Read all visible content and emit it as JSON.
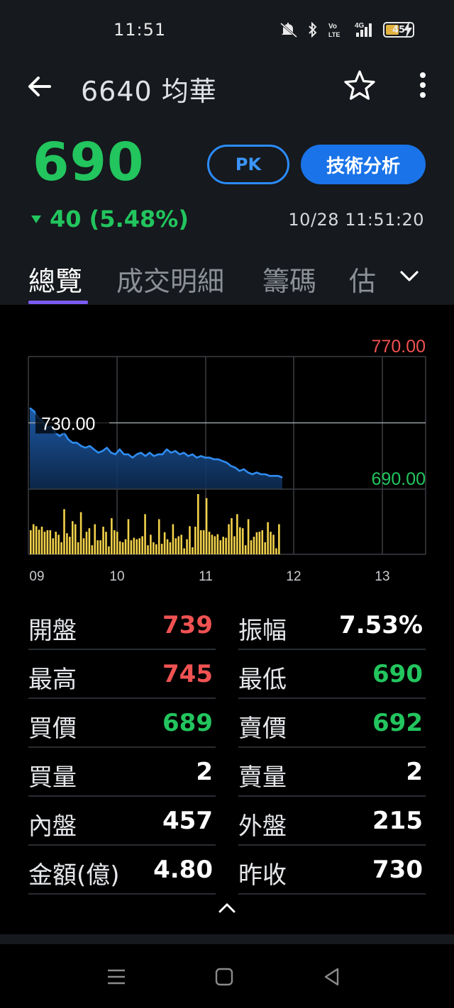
{
  "status_bar": {
    "time": "11:51",
    "battery": "45",
    "network": "4G"
  },
  "header": {
    "title": "6640 均華"
  },
  "quote": {
    "price": "690",
    "change": "40 (5.48%)",
    "timestamp": "10/28 11:51:20",
    "pk_label": "PK",
    "ta_label": "技術分析"
  },
  "tabs": [
    "總覽",
    "成交明細",
    "籌碼",
    "估"
  ],
  "colors": {
    "up": "#f05252",
    "down": "#22c55e",
    "accent": "#1a73e8",
    "tab_indicator": "#7c5cf5",
    "price_line": "#2f8cf0",
    "volume": "#f2d14a"
  },
  "chart_data": {
    "type": "area",
    "price_axis": {
      "max_label": "770.00",
      "ref_label": "730.00",
      "min_label": "690.00",
      "ylim": [
        690,
        770
      ],
      "reference": 730
    },
    "x_ticks": [
      "09",
      "10",
      "11",
      "12",
      "13"
    ],
    "time_range": [
      "09:00",
      "13:30"
    ],
    "series": [
      {
        "name": "price",
        "values": [
          739,
          737,
          733,
          731,
          727,
          728,
          724,
          722,
          724,
          720,
          718,
          718,
          716,
          715,
          716,
          714,
          712,
          713,
          715,
          712,
          711,
          714,
          711,
          711,
          709,
          711,
          712,
          710,
          712,
          710,
          711,
          711,
          714,
          712,
          713,
          711,
          712,
          710,
          711,
          709,
          710,
          709,
          709,
          708,
          708,
          707,
          706,
          704,
          703,
          701,
          702,
          700,
          699,
          700,
          699,
          699,
          698,
          698,
          698,
          697
        ]
      },
      {
        "name": "volume",
        "values": [
          8,
          6,
          4,
          7,
          5,
          3,
          6,
          4,
          2,
          5,
          3,
          4,
          9,
          3,
          5,
          6,
          4,
          3,
          7,
          2,
          5,
          4,
          3,
          6,
          2,
          4,
          5,
          3,
          2,
          6,
          3,
          5,
          2,
          4,
          3,
          5,
          4,
          3,
          2,
          4,
          3,
          5,
          2,
          3,
          4,
          2,
          5,
          3,
          4,
          2,
          3,
          5,
          2,
          4,
          3,
          2,
          3,
          4,
          2,
          5
        ]
      }
    ],
    "grid": true
  },
  "stats": [
    {
      "label": "開盤",
      "value": "739",
      "color": "up"
    },
    {
      "label": "振幅",
      "value": "7.53%",
      "color": "neutral"
    },
    {
      "label": "最高",
      "value": "745",
      "color": "up"
    },
    {
      "label": "最低",
      "value": "690",
      "color": "down"
    },
    {
      "label": "買價",
      "value": "689",
      "color": "down"
    },
    {
      "label": "賣價",
      "value": "692",
      "color": "down"
    },
    {
      "label": "買量",
      "value": "2",
      "color": "neutral"
    },
    {
      "label": "賣量",
      "value": "2",
      "color": "neutral"
    },
    {
      "label": "內盤",
      "value": "457",
      "color": "neutral"
    },
    {
      "label": "外盤",
      "value": "215",
      "color": "neutral"
    },
    {
      "label": "金額(億)",
      "value": "4.80",
      "color": "neutral"
    },
    {
      "label": "昨收",
      "value": "730",
      "color": "neutral"
    }
  ]
}
